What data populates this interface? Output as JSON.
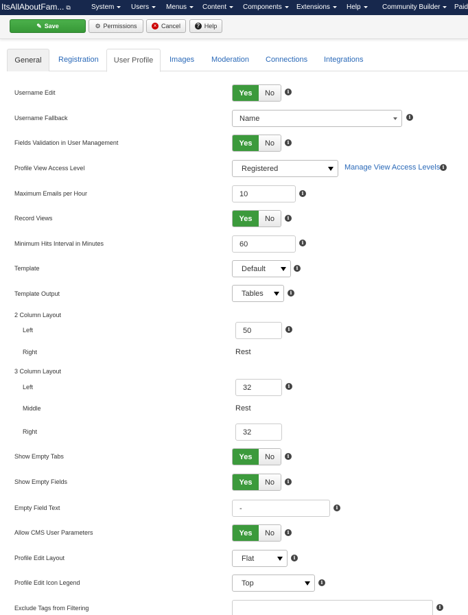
{
  "nav": {
    "brand": "ItsAllAboutFam...",
    "brand_icon": "external-link-icon",
    "items": [
      "System",
      "Users",
      "Menus",
      "Content",
      "Components",
      "Extensions",
      "Help",
      "Community Builder",
      "Paid"
    ]
  },
  "toolbar": {
    "save": "Save",
    "permissions": "Permissions",
    "cancel": "Cancel",
    "help": "Help"
  },
  "tabs": [
    "General",
    "Registration",
    "User Profile",
    "Images",
    "Moderation",
    "Connections",
    "Integrations"
  ],
  "active_tab": "User Profile",
  "colors": {
    "nav_bg": "#17284d",
    "yes_green": "#3c9a3c",
    "link_blue": "#2a69b8"
  },
  "form": {
    "username_edit": {
      "label": "Username Edit",
      "yes": "Yes",
      "no": "No"
    },
    "username_fallback": {
      "label": "Username Fallback",
      "value": "Name"
    },
    "fields_validation": {
      "label": "Fields Validation in User Management",
      "yes": "Yes",
      "no": "No"
    },
    "profile_view_access": {
      "label": "Profile View Access Level",
      "value": "Registered",
      "link": "Manage View Access Levels"
    },
    "max_emails": {
      "label": "Maximum Emails per Hour",
      "value": "10"
    },
    "record_views": {
      "label": "Record Views",
      "yes": "Yes",
      "no": "No"
    },
    "min_hits": {
      "label": "Minimum Hits Interval in Minutes",
      "value": "60"
    },
    "template": {
      "label": "Template",
      "value": "Default"
    },
    "template_output": {
      "label": "Template Output",
      "value": "Tables"
    },
    "two_col": {
      "label": "2 Column Layout",
      "left_label": "Left",
      "left_value": "50",
      "right_label": "Right",
      "right_value": "Rest"
    },
    "three_col": {
      "label": "3 Column Layout",
      "left_label": "Left",
      "left_value": "32",
      "middle_label": "Middle",
      "middle_value": "Rest",
      "right_label": "Right",
      "right_value": "32"
    },
    "show_empty_tabs": {
      "label": "Show Empty Tabs",
      "yes": "Yes",
      "no": "No"
    },
    "show_empty_fields": {
      "label": "Show Empty Fields",
      "yes": "Yes",
      "no": "No"
    },
    "empty_field_text": {
      "label": "Empty Field Text",
      "value": "-"
    },
    "allow_cms_params": {
      "label": "Allow CMS User Parameters",
      "yes": "Yes",
      "no": "No"
    },
    "profile_edit_layout": {
      "label": "Profile Edit Layout",
      "value": "Flat"
    },
    "icon_legend": {
      "label": "Profile Edit Icon Legend",
      "value": "Top"
    },
    "exclude_tags": {
      "label": "Exclude Tags from Filtering",
      "value": ""
    }
  }
}
